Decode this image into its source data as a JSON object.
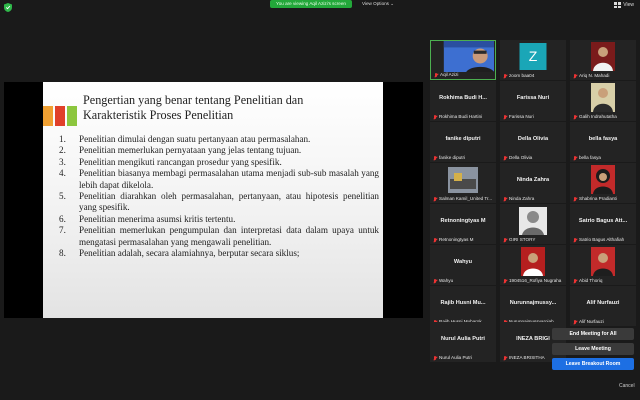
{
  "top": {
    "banner": "You are viewing Aqil Azizi's screen",
    "view_options": "View Options ⌄",
    "view": "View"
  },
  "slide": {
    "title": "Pengertian yang benar tentang Penelitian dan Karakteristik Proses Penelitian",
    "items": [
      {
        "n": "1.",
        "t": "Penelitian dimulai dengan suatu pertanyaan atau permasalahan."
      },
      {
        "n": "2.",
        "t": "Penelitian memerlukan pernyataan yang jelas tentang tujuan."
      },
      {
        "n": "3.",
        "t": "Penelitian mengikuti rancangan prosedur yang spesifik."
      },
      {
        "n": "4.",
        "t": "Penelitian biasanya membagi permasalahan utama menjadi sub-sub masalah yang lebih dapat dikelola."
      },
      {
        "n": "5.",
        "t": "Penelitian diarahkan oleh permasalahan, pertanyaan, atau hipotesis penelitian yang spesifik."
      },
      {
        "n": "6.",
        "t": "Penelitian menerima asumsi kritis tertentu."
      },
      {
        "n": "7.",
        "t": "Penelitian memerlukan pengumpulan dan interpretasi data dalam upaya untuk mengatasi permasalahan yang mengawali penelitian."
      },
      {
        "n": "8.",
        "t": "Penelitian adalah, secara alamiahnya, berputar secara siklus;"
      }
    ]
  },
  "tiles": {
    "aqil": {
      "label": "Aqil Azizi"
    },
    "zoom": {
      "label": "zoom baa04",
      "letter": "Z"
    },
    "ariq": {
      "label": "Ariq N. Mahadi"
    },
    "rokhima": {
      "big": "Rokhima Budi H...",
      "label": "Rokhima Budi Hartini"
    },
    "farissa": {
      "big": "Farissa Nuri",
      "label": "Farissa Nuri"
    },
    "galih": {
      "label": "Galih Indrahutatha"
    },
    "fanike": {
      "big": "fanike diputri",
      "label": "fanike diputri"
    },
    "della": {
      "big": "Della Olivia",
      "label": "Della Olivia"
    },
    "bella": {
      "big": "bella fasya",
      "label": "bella fasya"
    },
    "salman": {
      "label": "Salman Kamil_United Tr..."
    },
    "ninda": {
      "big": "Ninda Zahra",
      "label": "Ninda Zahra"
    },
    "shabrina": {
      "label": "Shabrina Pradianti"
    },
    "retno": {
      "big": "Retnoningtyas M",
      "label": "Retnoningtyas M"
    },
    "giri": {
      "label": "GIRI STORY"
    },
    "satrio": {
      "big": "Satrio Bagus Att...",
      "label": "Satrio Bagus Althafiah"
    },
    "wahyu": {
      "big": "Wahyu",
      "label": "Wahyu"
    },
    "rofiya": {
      "label": "1904516_Rofiya Nugraha"
    },
    "abid": {
      "label": "Abid Thoriq"
    },
    "rajib": {
      "big": "Rajib Husni Mu...",
      "label": "Rajib Husni Mubarok"
    },
    "nurunna": {
      "big": "Nurunnajmussy...",
      "label": "Nurunnajmussyarojah"
    },
    "alif": {
      "big": "Alif Nurfauzi",
      "label": "Alif Nurfauzi"
    },
    "nurul": {
      "big": "Nurul Aulia Putri",
      "label": "Nurul Aulia Putri"
    },
    "ineza": {
      "big": "INEZA BRIGI",
      "label": "INEZA BRISITHA"
    }
  },
  "controls": {
    "end_meeting_all": "End Meeting for All",
    "leave_meeting": "Leave Meeting",
    "leave_breakout": "Leave Breakout Room",
    "cancel": "Cancel"
  },
  "colors": {
    "banner": "#23a83a",
    "active_border": "#4caf50",
    "primary_button": "#1d6fe3",
    "zoom_avatar": "#1aa6b7",
    "slide_bar_orange": "#f0a032",
    "slide_bar_red": "#e0402a",
    "slide_bar_green": "#8cc63e"
  }
}
